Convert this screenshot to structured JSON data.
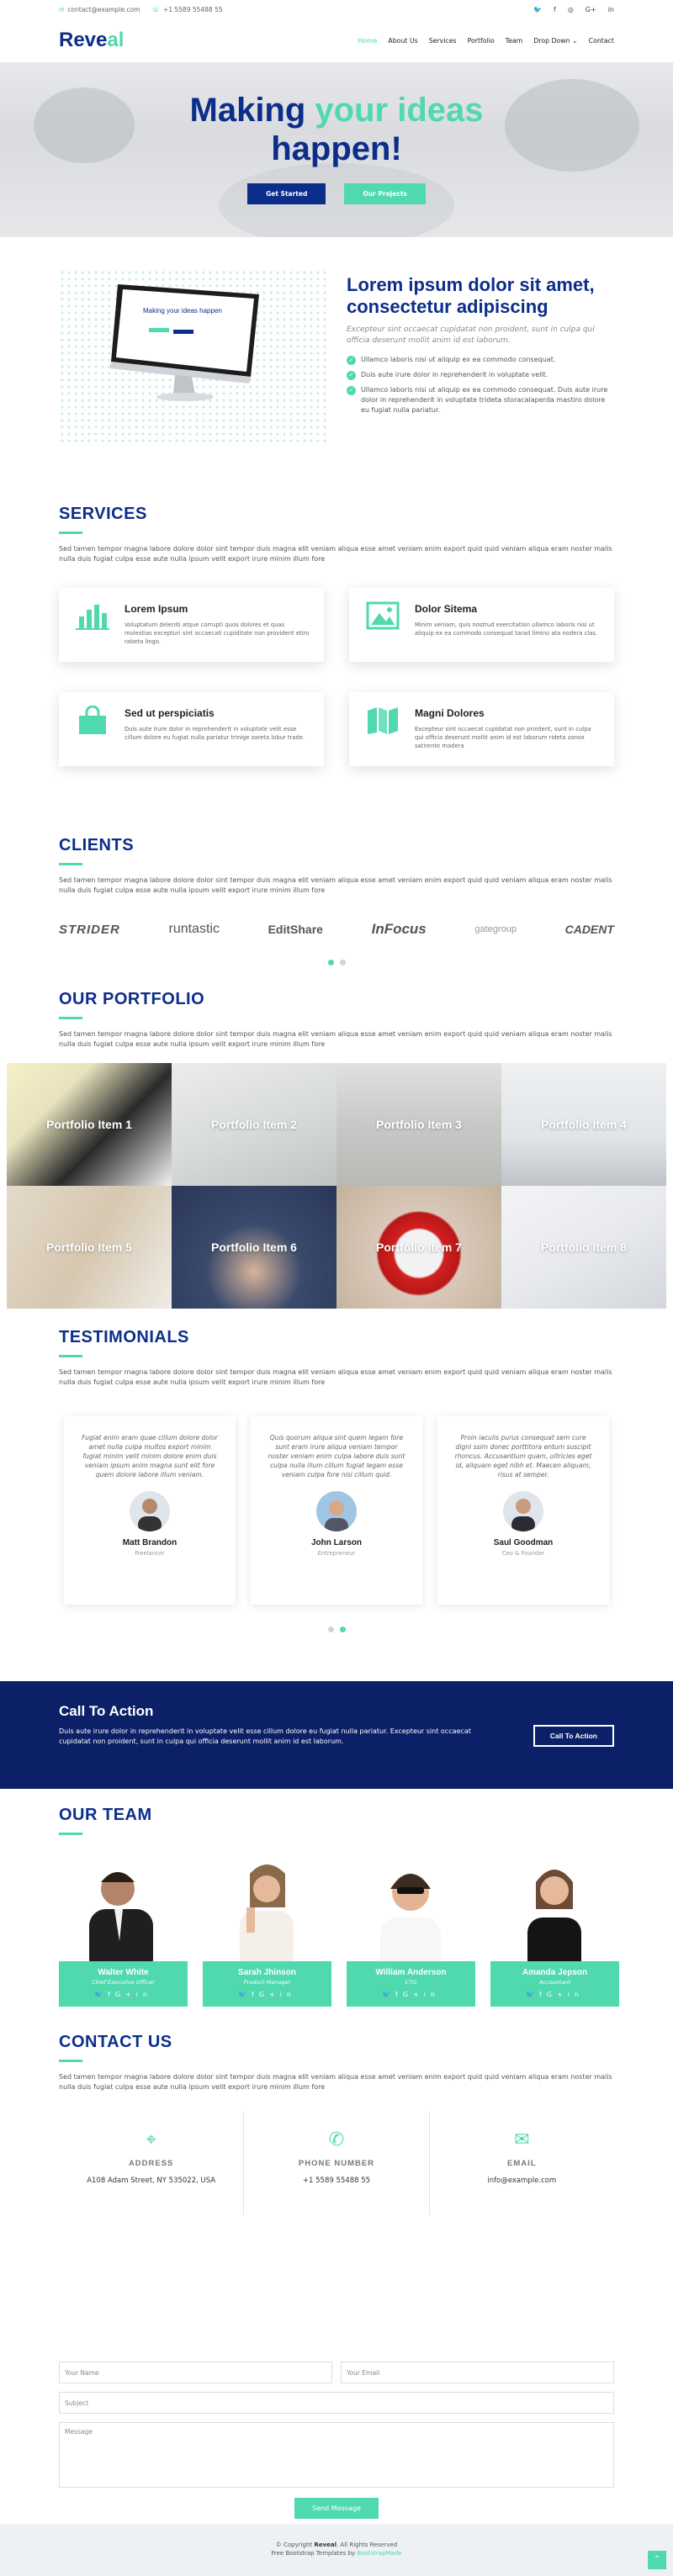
{
  "topbar": {
    "email": "contact@example.com",
    "phone": "+1 5589 55488 55",
    "social": [
      "twitter-icon",
      "facebook-icon",
      "instagram-icon",
      "google-plus-icon",
      "linkedin-icon"
    ]
  },
  "header": {
    "logo_main": "Reve",
    "logo_accent": "al",
    "nav": [
      "Home",
      "About Us",
      "Services",
      "Portfolio",
      "Team",
      "Drop Down",
      "Contact"
    ],
    "active_nav": "Home"
  },
  "hero": {
    "title_1": "Making ",
    "title_hl": "your ideas",
    "title_2": "happen!",
    "btn_primary": "Get Started",
    "btn_secondary": "Our Projects"
  },
  "about": {
    "title": "Lorem ipsum dolor sit amet, consectetur adipiscing",
    "lead": "Excepteur sint occaecat cupidatat non proident, sunt in culpa qui officia deserunt mollit anim id est laborum.",
    "bullets": [
      "Ullamco laboris nisi ut aliquip ex ea commodo consequat.",
      "Duis aute irure dolor in reprehenderit in voluptate velit.",
      "Ullamco laboris nisi ut aliquip ex ea commodo consequat. Duis aute irure dolor in reprehenderit in voluptate trideta storacalaperda mastiro dolore eu fugiat nulla pariatur."
    ],
    "screen_text": "Making your ideas happen"
  },
  "services": {
    "title": "SERVICES",
    "desc": "Sed tamen tempor magna labore dolore dolor sint tempor duis magna elit veniam aliqua esse amet veniam enim export quid quid veniam aliqua eram noster malis nulla duis fugiat culpa esse aute nulla ipsum velit export irure minim illum fore",
    "items": [
      {
        "icon": "bar-chart-icon",
        "title": "Lorem Ipsum",
        "text": "Voluptatum deleniti atque corrupti quos dolores et quas molestias excepturi sint occaecati cupiditate non provident etiro rabeta lingo."
      },
      {
        "icon": "picture-icon",
        "title": "Dolor Sitema",
        "text": "Minim veniam, quis nostrud exercitation ullamco laboris nisi ut aliquip ex ea commodo consequat tarad limino ata nodera clas."
      },
      {
        "icon": "shopping-bag-icon",
        "title": "Sed ut perspiciatis",
        "text": "Duis aute irure dolor in reprehenderit in voluptate velit esse cillum dolore eu fugiat nulla pariatur trinige zareta lobur trade."
      },
      {
        "icon": "map-icon",
        "title": "Magni Dolores",
        "text": "Excepteur sint occaecat cupidatat non proident, sunt in culpa qui officia deserunt mollit anim id est laborum rideta zanox satirente madera"
      }
    ]
  },
  "clients": {
    "title": "CLIENTS",
    "desc": "Sed tamen tempor magna labore dolore dolor sint tempor duis magna elit veniam aliqua esse amet veniam enim export quid quid veniam aliqua eram noster malis nulla duis fugiat culpa esse aute nulla ipsum velit export irure minim illum fore",
    "logos": [
      "STRIDER",
      "runtastic",
      "EditShare",
      "InFocus",
      "gategroup",
      "CADENT"
    ]
  },
  "portfolio": {
    "title": "OUR PORTFOLIO",
    "desc": "Sed tamen tempor magna labore dolore dolor sint tempor duis magna elit veniam aliqua esse amet veniam enim export quid quid veniam aliqua eram noster malis nulla duis fugiat culpa esse aute nulla ipsum velit export irure minim illum fore",
    "items": [
      "Portfolio Item 1",
      "Portfolio Item 2",
      "Portfolio Item 3",
      "Portfolio Item 4",
      "Portfolio Item 5",
      "Portfolio Item 6",
      "Portfolio Item 7",
      "Portfolio Item 8"
    ]
  },
  "testimonials": {
    "title": "TESTIMONIALS",
    "desc": "Sed tamen tempor magna labore dolore dolor sint tempor duis magna elit veniam aliqua esse amet veniam enim export quid quid veniam aliqua eram noster malis nulla duis fugiat culpa esse aute nulla ipsum velit export irure minim illum fore",
    "items": [
      {
        "quote": "Fugiat enim eram quae cillum dolore dolor amet nulla culpa multos export minim fugiat minim velit minim dolore enim duis veniam ipsum anim magna sunt elit fore quem dolore labore illum veniam.",
        "name": "Matt Brandon",
        "role": "Freelancer"
      },
      {
        "quote": "Quis quorum aliqua sint quem legam fore sunt eram irure aliqua veniam tempor noster veniam enim culpa labore duis sunt culpa nulla illum cillum fugiat legam esse veniam culpa fore nisi cillum quid.",
        "name": "John Larson",
        "role": "Entrepreneur"
      },
      {
        "quote": "Proin iaculis purus consequat sem cure digni ssim donec porttitora entum suscipit rhoncus. Accusantium quam, ultricies eget id, aliquam eget nibh et. Maecen aliquam, risus at semper.",
        "name": "Saul Goodman",
        "role": "Ceo & Founder"
      }
    ]
  },
  "cta": {
    "title": "Call To Action",
    "text": "Duis aute irure dolor in reprehenderit in voluptate velit esse cillum dolore eu fugiat nulla pariatur. Excepteur sint occaecat cupidatat non proident, sunt in culpa qui officia deserunt mollit anim id est laborum.",
    "button": "Call To Action"
  },
  "team": {
    "title": "OUR TEAM",
    "members": [
      {
        "name": "Walter White",
        "role": "Chief Executive Officer"
      },
      {
        "name": "Sarah Jhinson",
        "role": "Product Manager"
      },
      {
        "name": "William Anderson",
        "role": "CTO"
      },
      {
        "name": "Amanda Jepson",
        "role": "Accountant"
      }
    ]
  },
  "contact": {
    "title": "CONTACT US",
    "desc": "Sed tamen tempor magna labore dolore dolor sint tempor duis magna elit veniam aliqua esse amet veniam enim export quid quid veniam aliqua eram noster malis nulla duis fugiat culpa esse aute nulla ipsum velit export irure minim illum fore",
    "address_label": "ADDRESS",
    "address": "A108 Adam Street, NY 535022, USA",
    "phone_label": "PHONE NUMBER",
    "phone": "+1 5589 55488 55",
    "email_label": "EMAIL",
    "email": "info@example.com",
    "form": {
      "name": "Your Name",
      "email": "Your Email",
      "subject": "Subject",
      "message": "Message",
      "send": "Send Message"
    }
  },
  "footer": {
    "copyright_pre": "© Copyright ",
    "brand": "Reveal",
    "copyright_post": ". All Rights Reserved",
    "credit_pre": "Free Bootstrap Templates by ",
    "credit_link": "BootstrapMade"
  },
  "colors": {
    "accent": "#50d8af",
    "brand": "#0c2e8a",
    "cta_bg": "#0c2068"
  }
}
